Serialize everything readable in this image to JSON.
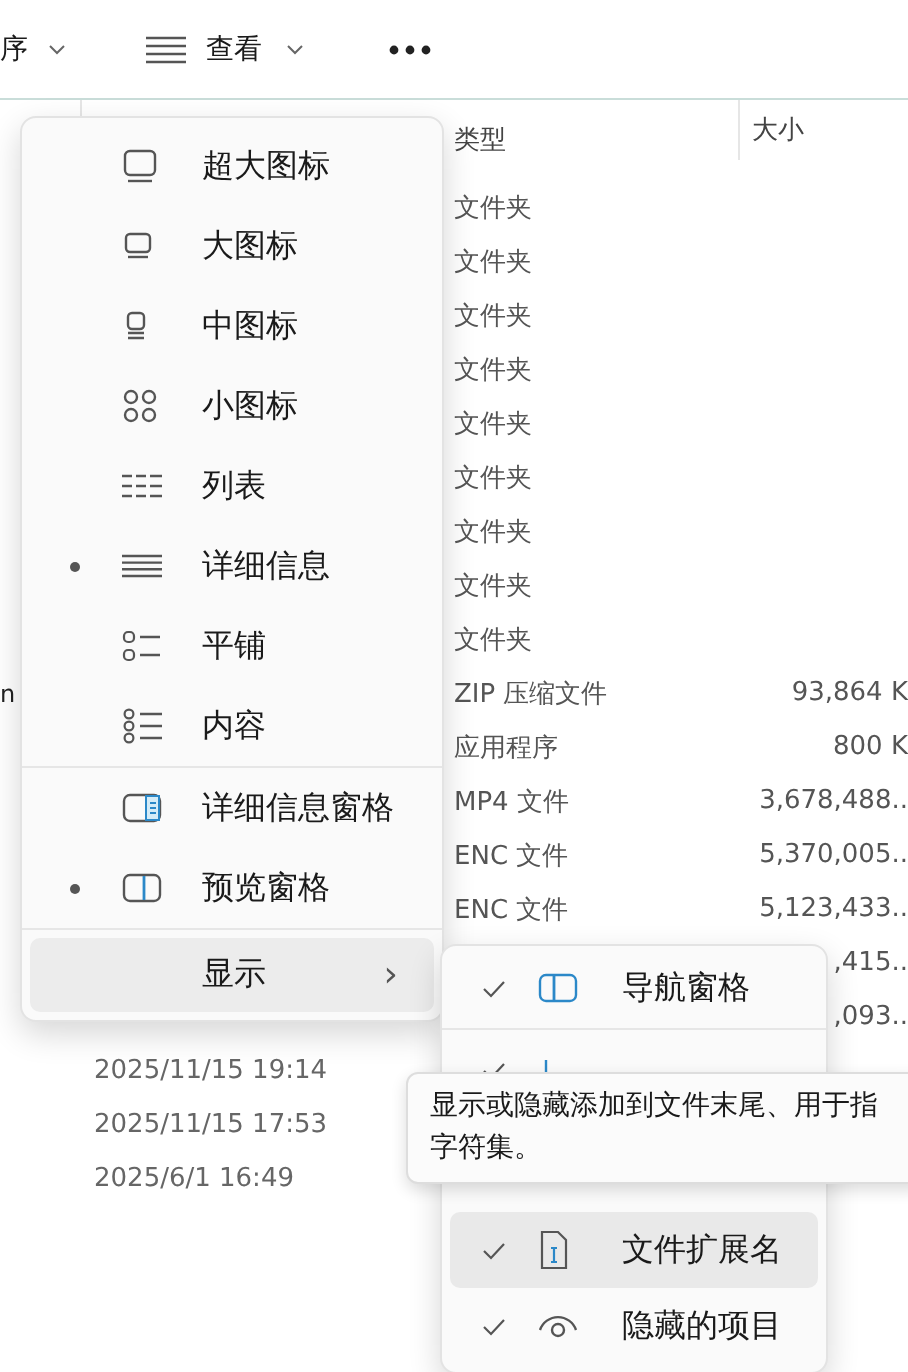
{
  "toolbar": {
    "sort_label": "序",
    "view_label": "查看"
  },
  "table": {
    "columns": [
      {},
      {},
      {
        "label": "类型"
      },
      {
        "label": "大小"
      }
    ],
    "rows": [
      {
        "type": "文件夹"
      },
      {
        "type": "文件夹"
      },
      {
        "type": "文件夹"
      },
      {
        "type": "文件夹"
      },
      {
        "type": "文件夹"
      },
      {
        "type": "文件夹"
      },
      {
        "type": "文件夹"
      },
      {
        "type": "文件夹"
      },
      {
        "type": "文件夹"
      },
      {
        "name": "n",
        "type": "ZIP 压缩文件",
        "size": "93,864 K"
      },
      {
        "type": "应用程序",
        "size": "800 K"
      },
      {
        "type": "MP4 文件",
        "size": "3,678,488.."
      },
      {
        "type": "ENC 文件",
        "size": "5,370,005.."
      },
      {
        "type": "ENC 文件",
        "size": "5,123,433.."
      },
      {
        "size": ",415.."
      },
      {
        "size": ",093.."
      },
      {
        "date": "2025/11/15 19:14"
      },
      {
        "date": "2025/11/15 17:53"
      },
      {
        "date": "2025/6/1 16:49"
      }
    ]
  },
  "view_menu": {
    "items": [
      {
        "kind": "xl",
        "label": "超大图标",
        "selected": false
      },
      {
        "kind": "lg",
        "label": "大图标",
        "selected": false
      },
      {
        "kind": "md",
        "label": "中图标",
        "selected": false
      },
      {
        "kind": "sm",
        "label": "小图标",
        "selected": false
      },
      {
        "kind": "list",
        "label": "列表",
        "selected": false
      },
      {
        "kind": "details",
        "label": "详细信息",
        "selected": true
      },
      {
        "kind": "tiles",
        "label": "平铺",
        "selected": false
      },
      {
        "kind": "content",
        "label": "内容",
        "selected": false
      },
      {
        "kind": "detailspane",
        "label": "详细信息窗格",
        "selected": false
      },
      {
        "kind": "previewpane",
        "label": "预览窗格",
        "selected": true
      }
    ],
    "show_item": {
      "label": "显示",
      "arrow": "›"
    }
  },
  "show_submenu": {
    "items": [
      {
        "kind": "nav",
        "label": "导航窗格",
        "checked": true,
        "hovered": false
      },
      {
        "kind": "compact",
        "checked": true,
        "hovered": false
      },
      {
        "kind": "ext",
        "label": "文件扩展名",
        "checked": true,
        "hovered": true
      },
      {
        "kind": "hidden",
        "label": "隐藏的项目",
        "checked": true,
        "hovered": false
      }
    ]
  },
  "tooltip": {
    "lines": [
      "显示或隐藏添加到文件末尾、用于指",
      "字符集。"
    ]
  }
}
